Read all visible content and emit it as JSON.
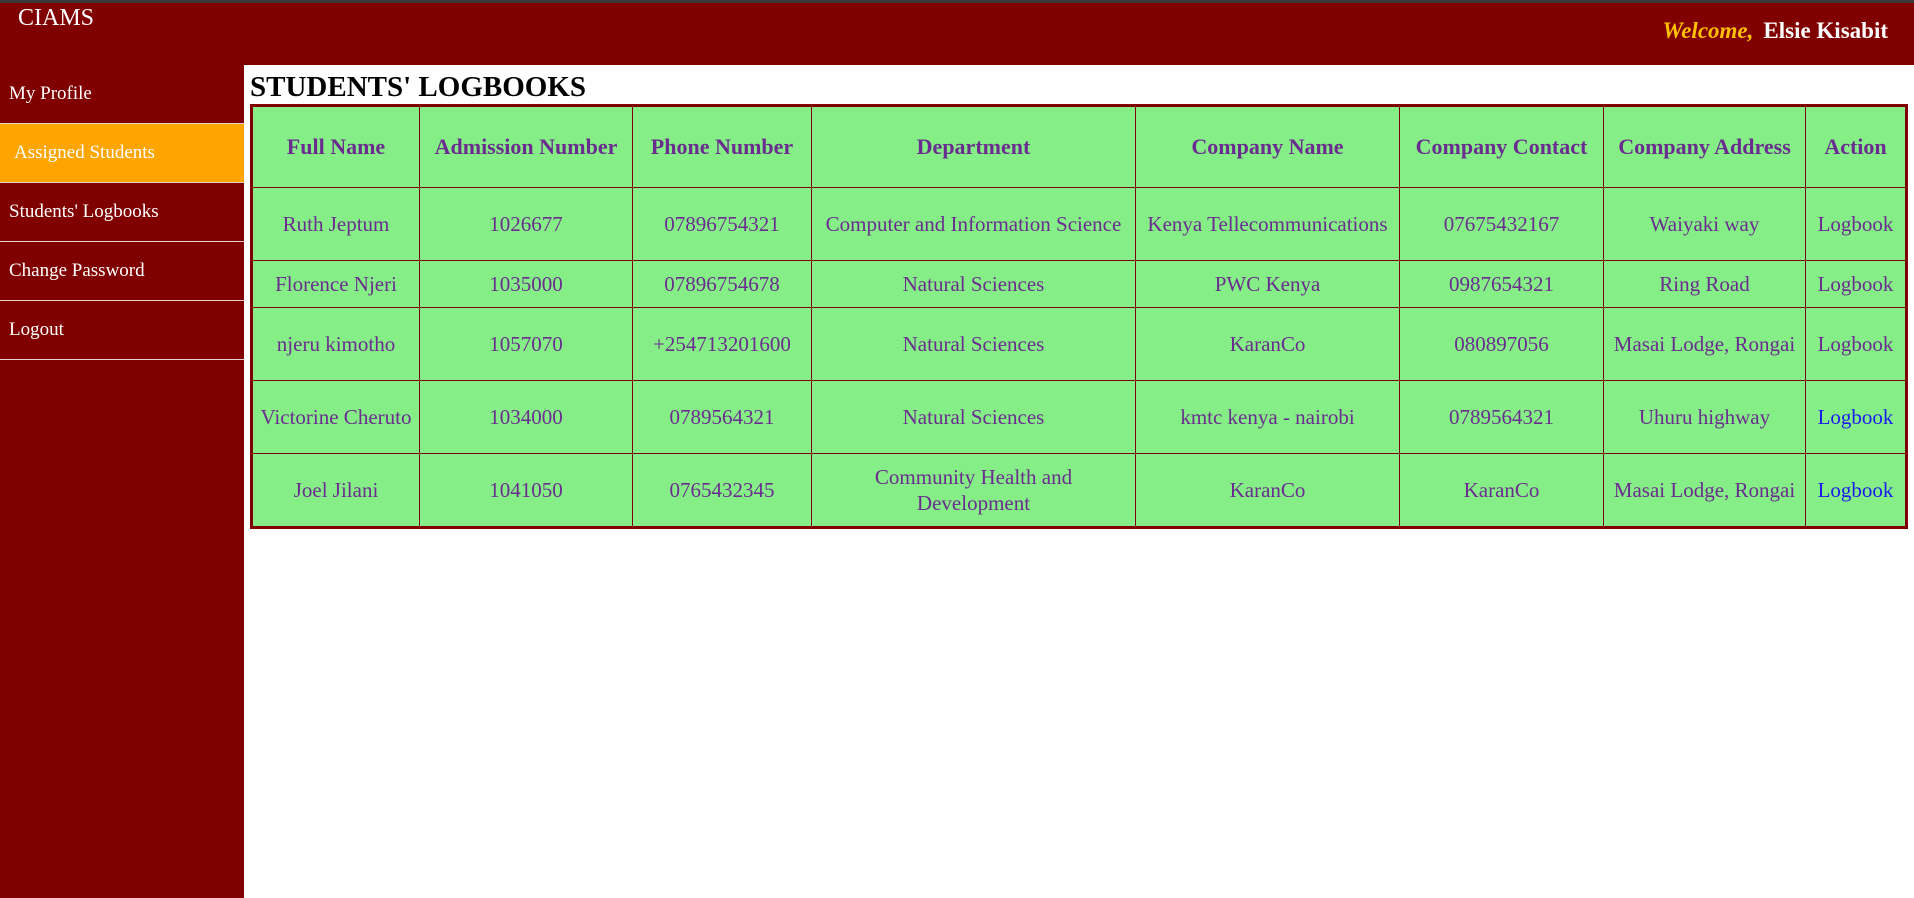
{
  "header": {
    "brand": "CIAMS",
    "welcome_label": "Welcome,",
    "user_name": "Elsie Kisabit"
  },
  "sidebar": {
    "items": [
      {
        "label": "My Profile"
      },
      {
        "label": "Assigned Students"
      },
      {
        "label": "Students' Logbooks"
      },
      {
        "label": "Change Password"
      },
      {
        "label": "Logout"
      }
    ],
    "active_index": 1
  },
  "main": {
    "title": "STUDENTS' LOGBOOKS"
  },
  "table": {
    "columns": [
      "Full Name",
      "Admission Number",
      "Phone Number",
      "Department",
      "Company Name",
      "Company Contact",
      "Company Address",
      "Action"
    ],
    "rows": [
      [
        "Ruth Jeptum",
        "1026677",
        "07896754321",
        "Computer and Information Science",
        "Kenya Tellecommunications",
        "07675432167",
        "Waiyaki way",
        "Logbook"
      ],
      [
        "Florence Njeri",
        "1035000",
        "07896754678",
        "Natural Sciences",
        "PWC Kenya",
        "0987654321",
        "Ring Road",
        "Logbook"
      ],
      [
        "njeru kimotho",
        "1057070",
        "+254713201600",
        "Natural Sciences",
        "KaranCo",
        "080897056",
        "Masai Lodge, Rongai",
        "Logbook"
      ],
      [
        "Victorine Cheruto",
        "1034000",
        "0789564321",
        "Natural Sciences",
        "kmtc kenya - nairobi",
        "0789564321",
        "Uhuru highway",
        "Logbook"
      ],
      [
        "Joel Jilani",
        "1041050",
        "0765432345",
        "Community Health and Development",
        "KaranCo",
        "KaranCo",
        "Masai Lodge, Rongai",
        "Logbook"
      ]
    ]
  },
  "colors": {
    "header_bg": "#800000",
    "active_nav": "#ffa500",
    "welcome": "#ffc000",
    "table_bg": "#86ee86",
    "table_text": "#6a2d8f",
    "link_blue": "#1a1aee"
  }
}
